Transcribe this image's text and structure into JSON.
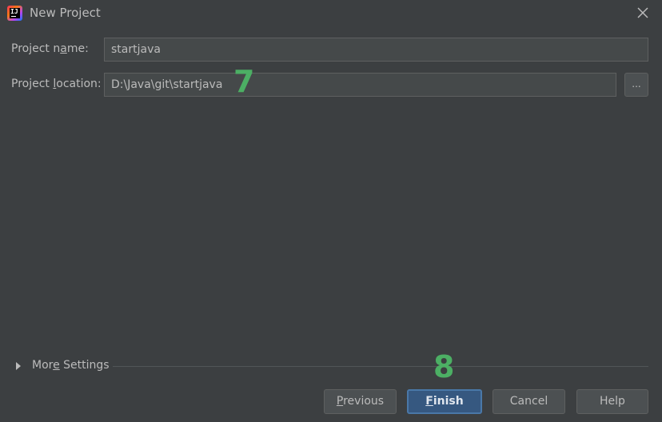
{
  "window": {
    "title": "New Project",
    "app_icon": "intellij-idea-icon",
    "app_icon_text": "IJ",
    "close_icon": "close-icon"
  },
  "form": {
    "project_name": {
      "label_pre": "Project n",
      "label_mnemonic": "a",
      "label_post": "me:",
      "value": "startjava"
    },
    "project_location": {
      "label_pre": "Project ",
      "label_mnemonic": "l",
      "label_post": "ocation:",
      "value": "D:\\Java\\git\\startjava",
      "browse_label": "..."
    }
  },
  "annotations": {
    "step_7": "7",
    "step_8": "8",
    "color": "#4caf64"
  },
  "more_settings": {
    "label_pre": "Mor",
    "label_mnemonic": "e",
    "label_post": " Settings",
    "expanded": false
  },
  "buttons": {
    "previous": {
      "mnemonic": "P",
      "rest": "revious",
      "enabled": true
    },
    "finish": {
      "mnemonic": "F",
      "rest": "inish",
      "default": true
    },
    "cancel": {
      "label": "Cancel"
    },
    "help": {
      "label": "Help"
    }
  },
  "colors": {
    "background": "#3c3f41",
    "field_background": "#45494a",
    "default_button": "#365880",
    "text": "#bbbbbb"
  }
}
